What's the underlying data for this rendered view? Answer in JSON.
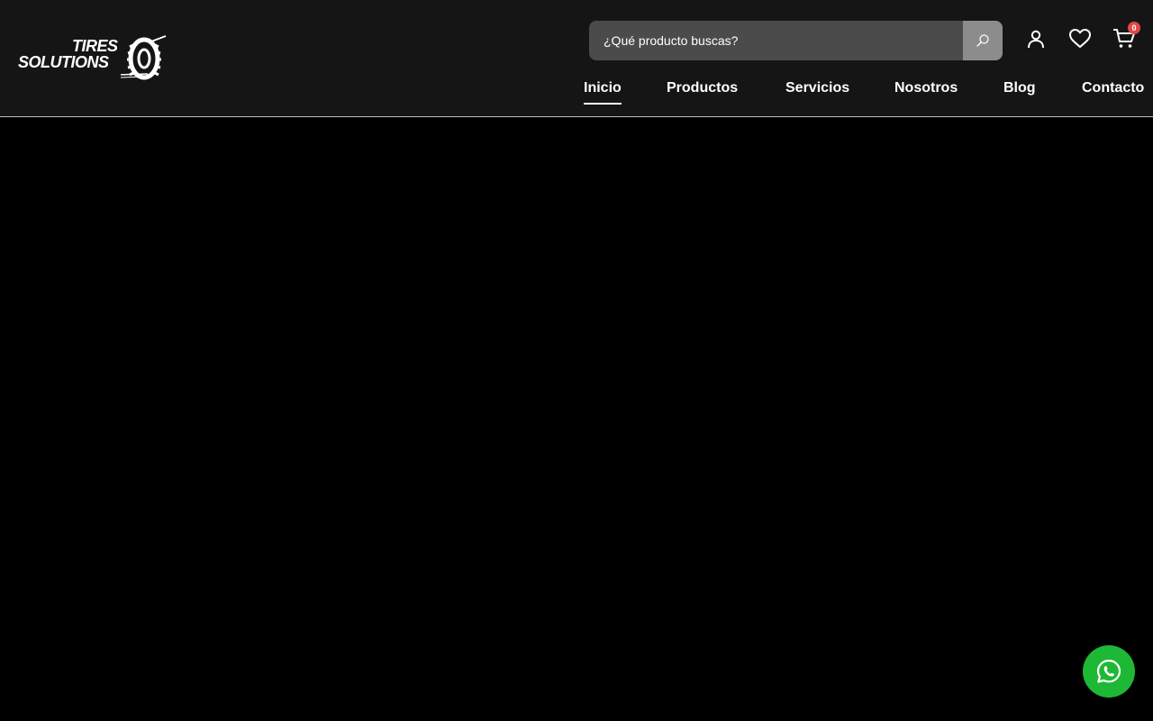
{
  "brand": {
    "logo_line1": "TIRES",
    "logo_line2": "SOLUTIONS"
  },
  "search": {
    "placeholder": "¿Qué producto buscas?",
    "value": "",
    "icon": "search-icon"
  },
  "header_icons": {
    "account_icon": "user-icon",
    "wishlist_icon": "heart-icon",
    "cart_icon": "cart-icon",
    "cart_count": "0"
  },
  "nav": {
    "items": [
      {
        "label": "Inicio",
        "active": true
      },
      {
        "label": "Productos",
        "active": false
      },
      {
        "label": "Servicios",
        "active": false
      },
      {
        "label": "Nosotros",
        "active": false
      },
      {
        "label": "Blog",
        "active": false
      },
      {
        "label": "Contacto",
        "active": false
      }
    ]
  },
  "floating": {
    "whatsapp_icon": "whatsapp-icon"
  },
  "colors": {
    "header_bg": "#151515",
    "page_bg": "#000000",
    "search_bg": "#4b4b4b",
    "search_button_bg": "#8c8c8c",
    "badge_bg": "#e04848",
    "whatsapp_bg": "#1db835",
    "text": "#ffffff"
  }
}
